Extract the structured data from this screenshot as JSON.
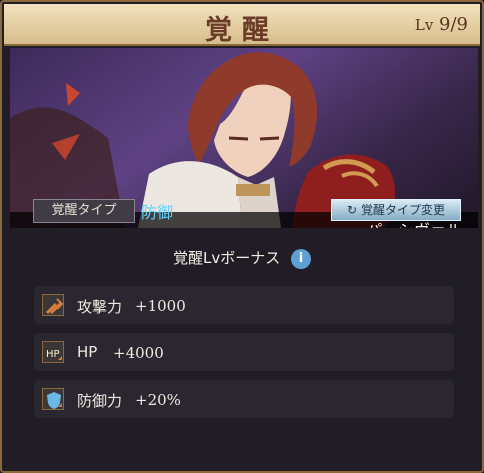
{
  "header": {
    "title": "覚醒",
    "level_prefix": "Lv",
    "level": "9/9"
  },
  "character": {
    "name": "パーシヴァル"
  },
  "awakening": {
    "type_label": "覚醒タイプ",
    "type_value": "防御",
    "change_button": "覚醒タイプ変更"
  },
  "bonus": {
    "title": "覚醒Lvボーナス",
    "info_icon": "i",
    "stats": [
      {
        "name": "攻撃力",
        "value": "+1000",
        "icon": "attack-icon"
      },
      {
        "name": "HP",
        "value": "+4000",
        "icon": "hp-icon"
      },
      {
        "name": "防御力",
        "value": "+20%",
        "icon": "defense-icon"
      }
    ]
  },
  "colors": {
    "accent": "#5ed2ff",
    "gold": "#8a6a3b",
    "header": "#e8d5ad"
  }
}
